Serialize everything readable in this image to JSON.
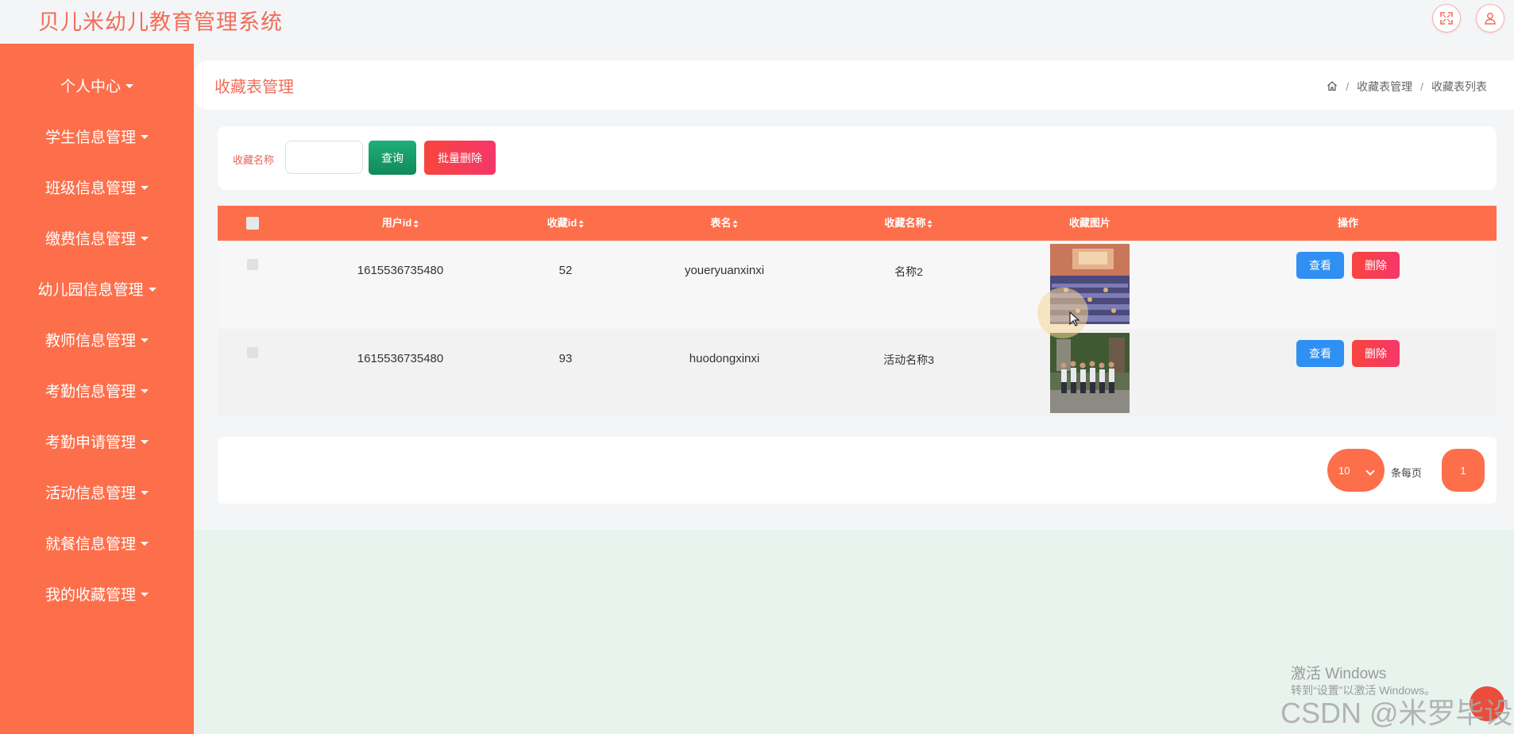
{
  "app": {
    "title": "贝儿米幼儿教育管理系统"
  },
  "topbar": {
    "fullscreen_icon": "fullscreen-icon",
    "user_icon": "user-icon"
  },
  "sidebar": {
    "items": [
      {
        "label": "个人中心"
      },
      {
        "label": "学生信息管理"
      },
      {
        "label": "班级信息管理"
      },
      {
        "label": "缴费信息管理"
      },
      {
        "label": "幼儿园信息管理"
      },
      {
        "label": "教师信息管理"
      },
      {
        "label": "考勤信息管理"
      },
      {
        "label": "考勤申请管理"
      },
      {
        "label": "活动信息管理"
      },
      {
        "label": "就餐信息管理"
      },
      {
        "label": "我的收藏管理"
      }
    ]
  },
  "header": {
    "title": "收藏表管理",
    "breadcrumb": [
      "收藏表管理",
      "收藏表列表"
    ],
    "home_icon": "home-icon"
  },
  "search": {
    "label": "收藏名称",
    "value": "",
    "query_label": "查询",
    "batch_delete_label": "批量删除"
  },
  "table": {
    "columns": [
      "用户id",
      "收藏id",
      "表名",
      "收藏名称",
      "收藏图片",
      "操作"
    ],
    "rows": [
      {
        "userid": "1615536735480",
        "refid": "52",
        "tablename": "youeryuanxinxi",
        "name": "名称2",
        "image": "auditorium-photo"
      },
      {
        "userid": "1615536735480",
        "refid": "93",
        "tablename": "huodongxinxi",
        "name": "活动名称3",
        "image": "group-photo"
      }
    ],
    "view_label": "查看",
    "delete_label": "删除"
  },
  "pagination": {
    "page_size": "10",
    "per_page_label": "条每页",
    "current_page": "1"
  },
  "watermark": {
    "line1": "激活 Windows",
    "line2": "转到“设置”以激活 Windows。",
    "csdn": "CSDN @米罗毕设"
  },
  "colors": {
    "primary": "#fd6f4b",
    "title": "#f26d5a",
    "query": "#16996a",
    "danger": "#f5405a",
    "view": "#2f8ff2"
  }
}
